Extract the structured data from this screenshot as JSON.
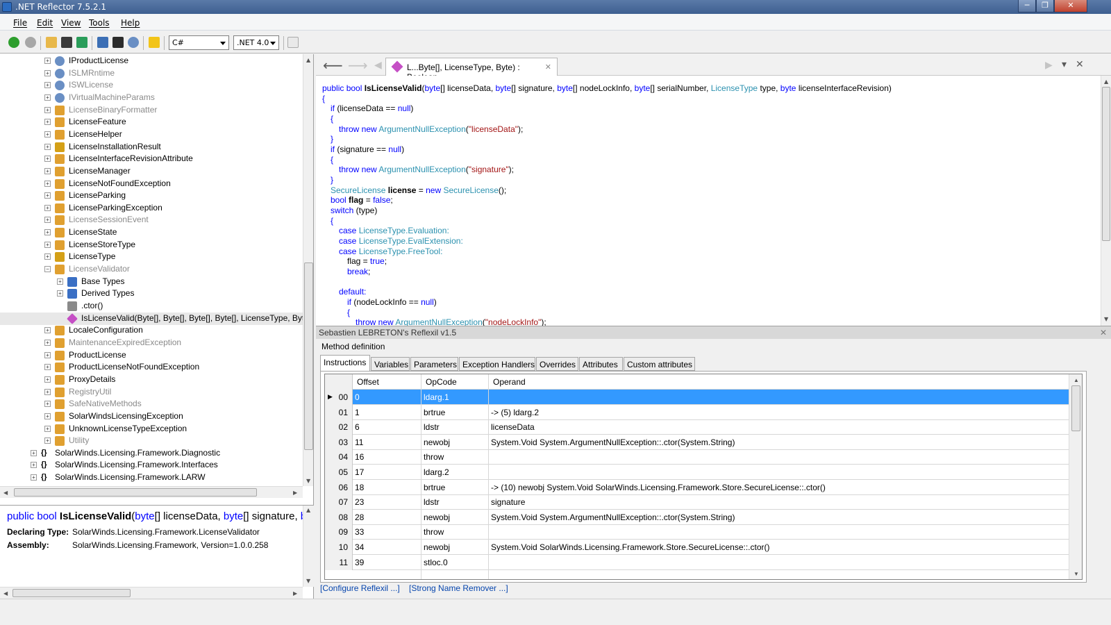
{
  "window": {
    "title": ".NET Reflector 7.5.2.1",
    "min": "─",
    "max": "❐",
    "close": "✕"
  },
  "menu": [
    "File",
    "Edit",
    "View",
    "Tools",
    "Help"
  ],
  "toolbar": {
    "language": "C#",
    "framework": ".NET 4.0"
  },
  "tree": [
    {
      "label": "IProductLicense",
      "icon": "interface-icon",
      "gray": false
    },
    {
      "label": "ISLMRntime",
      "icon": "interface-icon",
      "gray": true
    },
    {
      "label": "ISWLicense",
      "icon": "interface-icon",
      "gray": true
    },
    {
      "label": "IVirtualMachineParams",
      "icon": "interface-icon",
      "gray": true
    },
    {
      "label": "LicenseBinaryFormatter",
      "icon": "class-icon",
      "gray": true
    },
    {
      "label": "LicenseFeature",
      "icon": "class-icon",
      "gray": false
    },
    {
      "label": "LicenseHelper",
      "icon": "class-icon",
      "gray": false
    },
    {
      "label": "LicenseInstallationResult",
      "icon": "enum-icon",
      "gray": false
    },
    {
      "label": "LicenseInterfaceRevisionAttribute",
      "icon": "class-icon",
      "gray": false
    },
    {
      "label": "LicenseManager",
      "icon": "class-icon",
      "gray": false
    },
    {
      "label": "LicenseNotFoundException",
      "icon": "class-icon",
      "gray": false
    },
    {
      "label": "LicenseParking",
      "icon": "class-icon",
      "gray": false
    },
    {
      "label": "LicenseParkingException",
      "icon": "class-icon",
      "gray": false
    },
    {
      "label": "LicenseSessionEvent",
      "icon": "class-icon",
      "gray": true
    },
    {
      "label": "LicenseState",
      "icon": "class-icon",
      "gray": false
    },
    {
      "label": "LicenseStoreType",
      "icon": "class-icon",
      "gray": false
    },
    {
      "label": "LicenseType",
      "icon": "enum-icon",
      "gray": false
    },
    {
      "label": "LicenseValidator",
      "icon": "class-icon",
      "gray": true,
      "expanded": true
    },
    {
      "label": "Base Types",
      "icon": "base-types-icon",
      "gray": false,
      "level": 1
    },
    {
      "label": "Derived Types",
      "icon": "derived-types-icon",
      "gray": false,
      "level": 1
    },
    {
      "label": ".ctor()",
      "icon": "constructor-icon",
      "gray": false,
      "level": 1,
      "leaf": true
    },
    {
      "label": "IsLicenseValid(Byte[], Byte[], Byte[], Byte[], LicenseType, Byte)",
      "icon": "method-icon",
      "gray": false,
      "level": 1,
      "leaf": true,
      "selected": true
    },
    {
      "label": "LocaleConfiguration",
      "icon": "class-icon",
      "gray": false
    },
    {
      "label": "MaintenanceExpiredException",
      "icon": "class-icon",
      "gray": true
    },
    {
      "label": "ProductLicense",
      "icon": "class-icon",
      "gray": false
    },
    {
      "label": "ProductLicenseNotFoundException",
      "icon": "class-icon",
      "gray": false
    },
    {
      "label": "ProxyDetails",
      "icon": "class-icon",
      "gray": false
    },
    {
      "label": "RegistryUtil",
      "icon": "class-icon",
      "gray": true
    },
    {
      "label": "SafeNativeMethods",
      "icon": "class-icon",
      "gray": true
    },
    {
      "label": "SolarWindsLicensingException",
      "icon": "class-icon",
      "gray": false
    },
    {
      "label": "UnknownLicenseTypeException",
      "icon": "class-icon",
      "gray": false
    },
    {
      "label": "Utility",
      "icon": "class-icon",
      "gray": true
    },
    {
      "label": "SolarWinds.Licensing.Framework.Diagnostic",
      "icon": "namespace-icon",
      "gray": false,
      "level": -1
    },
    {
      "label": "SolarWinds.Licensing.Framework.Interfaces",
      "icon": "namespace-icon",
      "gray": false,
      "level": -1
    },
    {
      "label": "SolarWinds.Licensing.Framework.LARW",
      "icon": "namespace-icon",
      "gray": false,
      "level": -1
    }
  ],
  "info": {
    "sig_kw1": "public",
    "sig_kw2": "bool",
    "sig_name": "IsLicenseValid",
    "sig_rest_a": "(",
    "sig_t1": "byte",
    "sig_p1": "[] licenseData, ",
    "sig_t2": "byte",
    "sig_p2": "[] signature, ",
    "sig_t3": "by",
    "declaring_label": "Declaring Type:",
    "declaring_value": "SolarWinds.Licensing.Framework.LicenseValidator",
    "assembly_label": "Assembly:",
    "assembly_value": "SolarWinds.Licensing.Framework, Version=1.0.0.258"
  },
  "doc_tab": {
    "title": "L...Byte[], LicenseType, Byte) : Boolean",
    "close": "✕"
  },
  "reflexil": {
    "header": "Sebastien LEBRETON's Reflexil v1.5",
    "section": "Method definition",
    "tabs": [
      "Instructions",
      "Variables",
      "Parameters",
      "Exception Handlers",
      "Overrides",
      "Attributes",
      "Custom attributes"
    ],
    "columns": [
      "Offset",
      "OpCode",
      "Operand"
    ],
    "rows": [
      {
        "idx": "00",
        "offset": "0",
        "opcode": "ldarg.1",
        "operand": ""
      },
      {
        "idx": "01",
        "offset": "1",
        "opcode": "brtrue",
        "operand": "-> (5) ldarg.2"
      },
      {
        "idx": "02",
        "offset": "6",
        "opcode": "ldstr",
        "operand": "licenseData"
      },
      {
        "idx": "03",
        "offset": "11",
        "opcode": "newobj",
        "operand": "System.Void System.ArgumentNullException::.ctor(System.String)"
      },
      {
        "idx": "04",
        "offset": "16",
        "opcode": "throw",
        "operand": ""
      },
      {
        "idx": "05",
        "offset": "17",
        "opcode": "ldarg.2",
        "operand": ""
      },
      {
        "idx": "06",
        "offset": "18",
        "opcode": "brtrue",
        "operand": "-> (10) newobj System.Void SolarWinds.Licensing.Framework.Store.SecureLicense::.ctor()"
      },
      {
        "idx": "07",
        "offset": "23",
        "opcode": "ldstr",
        "operand": "signature"
      },
      {
        "idx": "08",
        "offset": "28",
        "opcode": "newobj",
        "operand": "System.Void System.ArgumentNullException::.ctor(System.String)"
      },
      {
        "idx": "09",
        "offset": "33",
        "opcode": "throw",
        "operand": ""
      },
      {
        "idx": "10",
        "offset": "34",
        "opcode": "newobj",
        "operand": "System.Void SolarWinds.Licensing.Framework.Store.SecureLicense::.ctor()"
      },
      {
        "idx": "11",
        "offset": "39",
        "opcode": "stloc.0",
        "operand": ""
      }
    ],
    "links": [
      "[Configure Reflexil ...]",
      "[Strong Name Remover ...]"
    ]
  },
  "code": {
    "l1": {
      "a": "public bool ",
      "b": "IsLicenseValid",
      "c": "(",
      "d": "byte",
      "e": "[] licenseData, ",
      "f": "byte",
      "g": "[] signature, ",
      "h": "byte",
      "i": "[] nodeLockInfo, ",
      "j": "byte",
      "k": "[] serialNumber, ",
      "l": "LicenseType",
      "m": " type, ",
      "n": "byte",
      "o": " licenseInterfaceRevision)"
    },
    "open": "{",
    "close": "}",
    "if1_a": "if",
    "if1_b": " (licenseData == ",
    "if1_c": "null",
    "if1_d": ")",
    "throw_kw": "throw new ",
    "throw_type": "ArgumentNullException",
    "throw_p1": "(",
    "throw_s1": "\"licenseData\"",
    "throw_p2": ");",
    "if2_b": " (signature == ",
    "throw_s2": "\"signature\"",
    "sec_type": "SecureLicense",
    "sec_var": "license",
    "sec_eq": " = ",
    "sec_new": "new ",
    "sec_tail": "();",
    "bool_kw": "bool ",
    "flag_var": "flag",
    "flag_eq": " = ",
    "false_kw": "false",
    "semi": ";",
    "switch_kw": "switch",
    "switch_tail": " (type)",
    "case_kw": "case ",
    "case1": "LicenseType.Evaluation:",
    "case2": "LicenseType.EvalExtension:",
    "case3": "LicenseType.FreeTool:",
    "flag_assign": "flag = ",
    "true_kw": "true",
    "break_kw": "break",
    "default_kw": "default:",
    "if3_b": " (nodeLockInfo == ",
    "throw_s3": "\"nodeLockInfo\""
  }
}
